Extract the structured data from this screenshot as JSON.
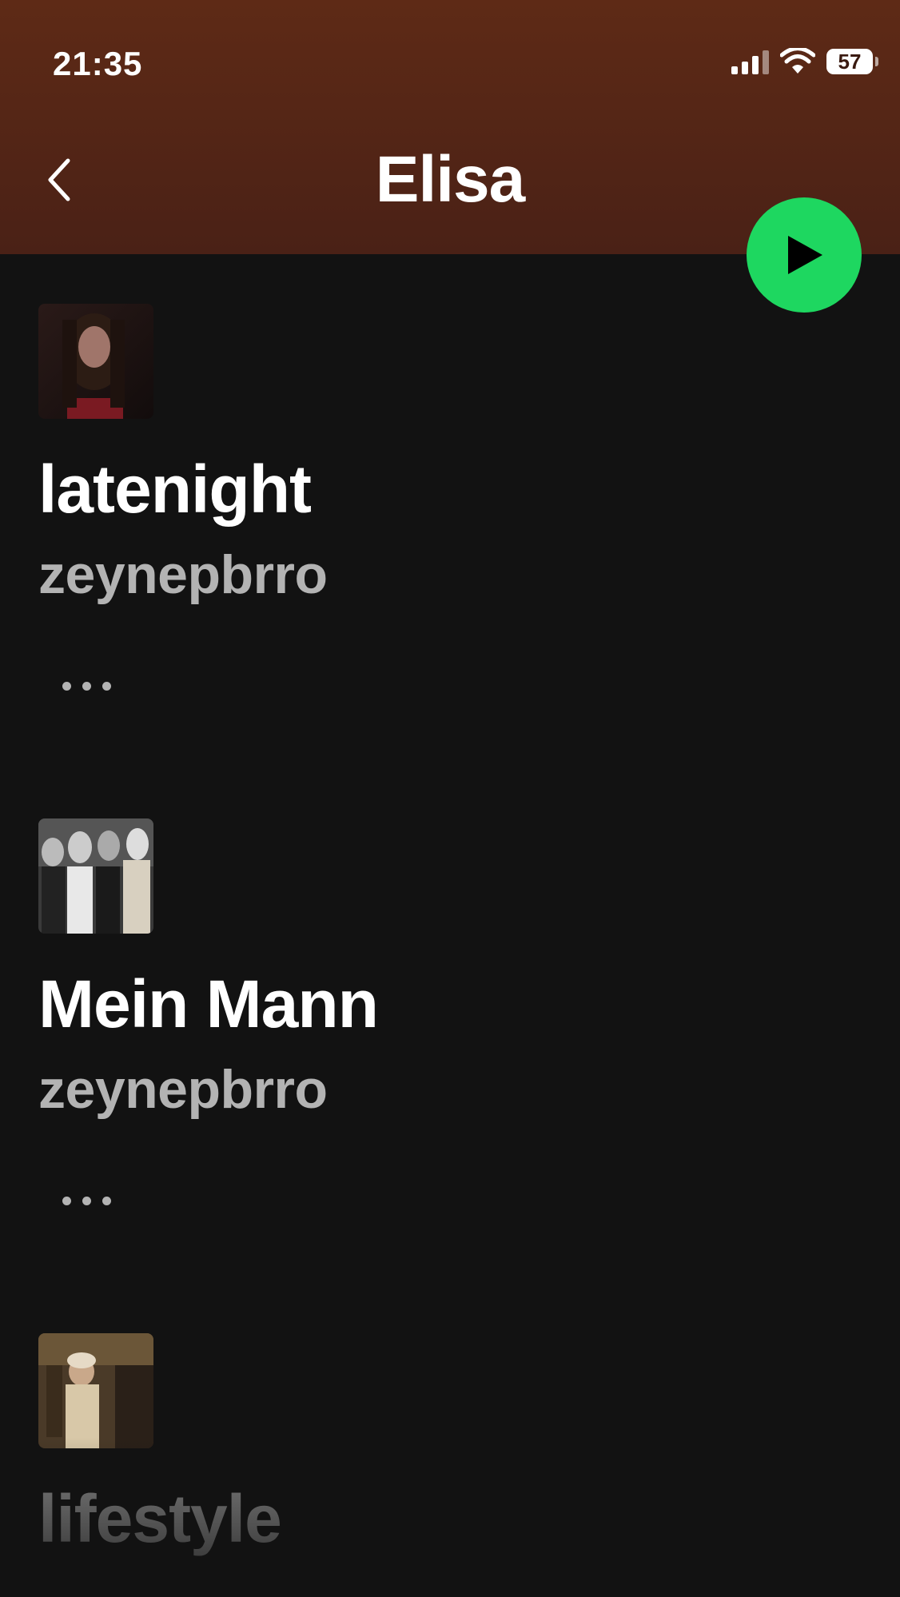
{
  "status_bar": {
    "time": "21:35",
    "battery_level": "57",
    "icons": [
      "cellular-signal-icon",
      "wifi-icon",
      "battery-icon"
    ]
  },
  "header": {
    "title": "Elisa",
    "back_icon": "chevron-left-icon",
    "play_icon": "play-icon"
  },
  "colors": {
    "header_top": "#5e2a16",
    "background": "#121212",
    "accent_green": "#1ed760",
    "secondary_text": "#b3b3b3"
  },
  "playlists": [
    {
      "title": "latenight",
      "owner": "zeynepbrro",
      "more_icon": "more-options-icon"
    },
    {
      "title": "Mein Mann",
      "owner": "zeynepbrro",
      "more_icon": "more-options-icon"
    },
    {
      "title": "lifestyle"
    }
  ]
}
